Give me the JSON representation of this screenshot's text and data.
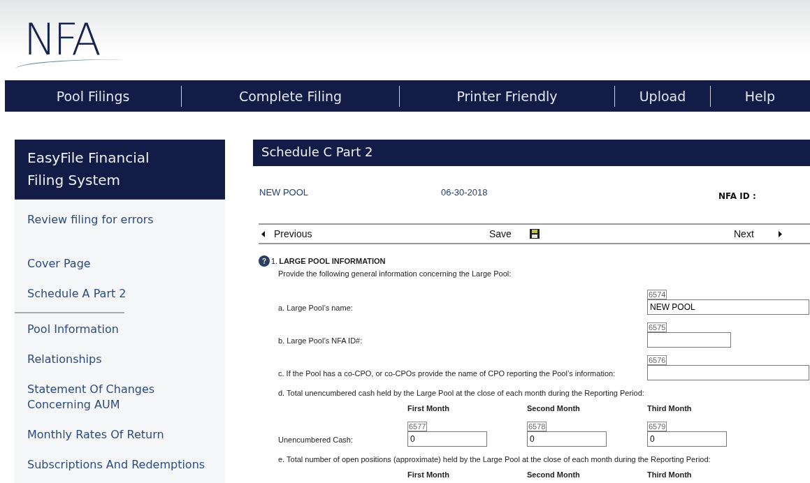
{
  "logo": {
    "text": "NFA"
  },
  "nav": [
    {
      "label": "Pool Filings"
    },
    {
      "label": "Complete Filing"
    },
    {
      "label": "Printer Friendly"
    },
    {
      "label": "Upload"
    },
    {
      "label": "Help"
    }
  ],
  "sidebar": {
    "title": "EasyFile Financial Filing System",
    "sections": [
      {
        "kind": "spaced",
        "items": [
          "Review filing for errors"
        ]
      },
      {
        "kind": "ruled",
        "items": [
          "Cover Page",
          "Schedule A Part 2"
        ]
      },
      {
        "kind": "plain",
        "items": [
          "Pool Information",
          "Relationships",
          "Statement Of Changes Concerning AUM",
          "Monthly Rates Of Return",
          "Subscriptions And Redemptions"
        ]
      }
    ]
  },
  "main": {
    "title": "Schedule C Part 2",
    "pool_name": "NEW POOL",
    "date": "06-30-2018",
    "nfa_id_label": "NFA ID :",
    "pager": {
      "previous": "Previous",
      "save": "Save",
      "next": "Next"
    },
    "form": {
      "number": "1.",
      "title": "LARGE POOL INFORMATION",
      "intro": "Provide the following general information concerning the Large Pool:",
      "questions": [
        {
          "kind": "long-text",
          "label": "a. Large Pool’s name:",
          "code": "6574",
          "value": "NEW POOL"
        },
        {
          "kind": "short-text",
          "label": "b. Large Pool’s NFA ID#:",
          "code": "6575"
        },
        {
          "kind": "long-text",
          "label": "c. If the Pool has a co-CPO, or co-CPOs provide the name of CPO reporting the Pool’s information:",
          "code": "6576"
        },
        {
          "kind": "monthly",
          "label": "d. Total unencumbered cash held by the Large Pool at the close of each month during the Reporting Period:",
          "columns": [
            "First Month",
            "Second Month",
            "Third Month"
          ],
          "rows": [
            {
              "label": "Unencumbered Cash:",
              "cells": [
                {
                  "code": "6577",
                  "value": "0"
                },
                {
                  "code": "6578",
                  "value": "0"
                },
                {
                  "code": "6579",
                  "value": "0"
                }
              ]
            }
          ]
        },
        {
          "kind": "monthly",
          "label": "e. Total number of open positions (approximate) held by the Large Pool at the close of each month during the Reporting Period:",
          "columns": [
            "First Month",
            "Second Month",
            "Third Month"
          ]
        }
      ]
    }
  }
}
